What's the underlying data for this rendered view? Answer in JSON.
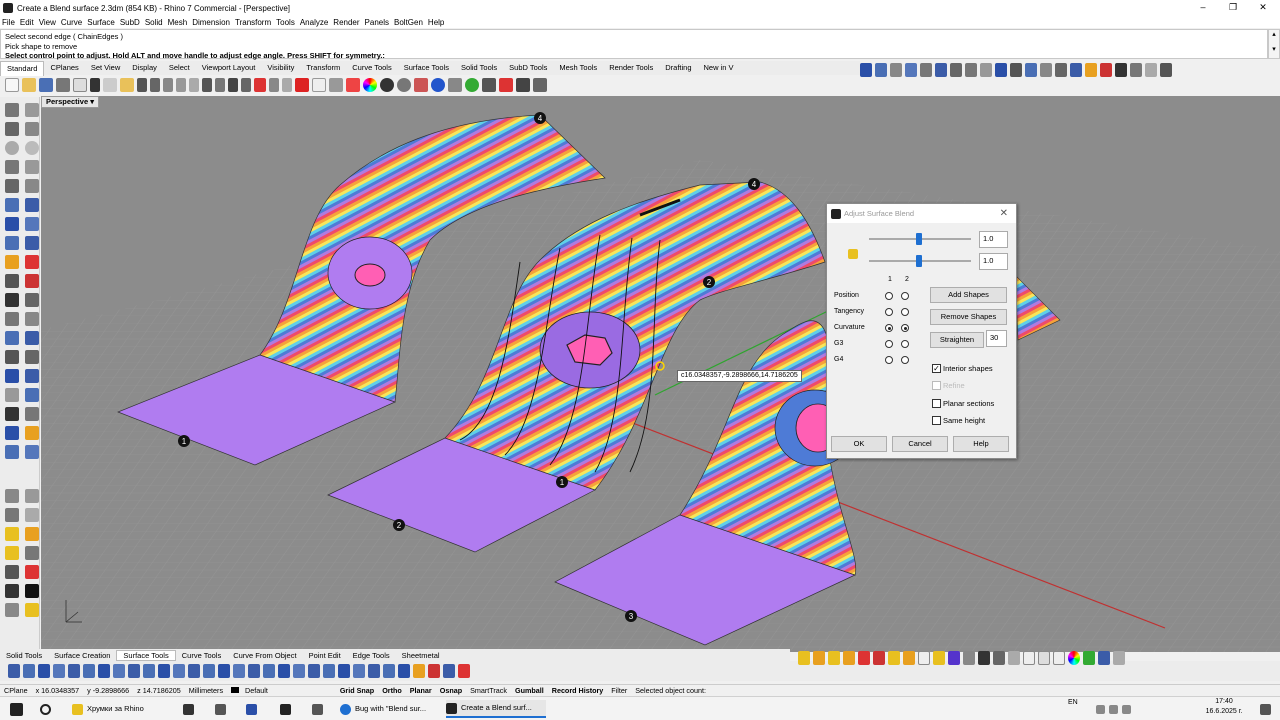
{
  "window": {
    "title": "Create a Blend surface 2.3dm (854 KB) - Rhino 7 Commercial - [Perspective]",
    "controls": [
      "–",
      "❐",
      "✕"
    ]
  },
  "menu": [
    "File",
    "Edit",
    "View",
    "Curve",
    "Surface",
    "SubD",
    "Solid",
    "Mesh",
    "Dimension",
    "Transform",
    "Tools",
    "Analyze",
    "Render",
    "Panels",
    "BoltGen",
    "Help"
  ],
  "command_history": {
    "line1": "Select second edge ( ChainEdges )",
    "line2": "Pick shape to remove",
    "prompt": "Select control point to adjust. Hold ALT and move handle to adjust edge angle. Press SHIFT for symmetry.:"
  },
  "toolbar_tabs": [
    "Standard",
    "CPlanes",
    "Set View",
    "Display",
    "Select",
    "Viewport Layout",
    "Visibility",
    "Transform",
    "Curve Tools",
    "Surface Tools",
    "Solid Tools",
    "SubD Tools",
    "Mesh Tools",
    "Render Tools",
    "Drafting",
    "New in V"
  ],
  "viewport": {
    "label": "Perspective",
    "coordinate_tooltip": "c16.0348357,-9.2898666,14.7186205",
    "markers": [
      "1",
      "2",
      "3",
      "4"
    ]
  },
  "dialog": {
    "title": "Adjust Surface Blend",
    "slider1_value": "1.0",
    "slider2_value": "1.0",
    "col1": "1",
    "col2": "2",
    "rows": [
      {
        "label": "Position",
        "r1": false,
        "r2": false
      },
      {
        "label": "Tangency",
        "r1": false,
        "r2": false
      },
      {
        "label": "Curvature",
        "r1": true,
        "r2": true
      },
      {
        "label": "G3",
        "r1": false,
        "r2": false
      },
      {
        "label": "G4",
        "r1": false,
        "r2": false
      }
    ],
    "add_shapes": "Add Shapes",
    "remove_shapes": "Remove Shapes",
    "straighten": "Straighten",
    "straighten_value": "30",
    "interior_shapes": "Interior shapes",
    "refine": "Refine",
    "planar_sections": "Planar sections",
    "same_height": "Same height",
    "ok": "OK",
    "cancel": "Cancel",
    "help": "Help"
  },
  "bottom_tabs": [
    "Solid Tools",
    "Surface Creation",
    "Surface Tools",
    "Curve Tools",
    "Curve From Object",
    "Point Edit",
    "Edge Tools",
    "Sheetmetal"
  ],
  "status": {
    "cplane": "CPlane",
    "x": "x 16.0348357",
    "y": "y -9.2898666",
    "z": "z 14.7186205",
    "units": "Millimeters",
    "layer": "Default",
    "toggles": [
      "Grid Snap",
      "Ortho",
      "Planar",
      "Osnap",
      "SmartTrack",
      "Gumball",
      "Record History",
      "Filter"
    ],
    "message": "Selected object count:"
  },
  "taskbar": {
    "items": [
      "Хрумки за Rhino",
      "Bug with \"Blend sur...",
      "Create a Blend surf..."
    ],
    "lang": "EN",
    "time": "17:40",
    "date": "16.6.2025 г."
  }
}
